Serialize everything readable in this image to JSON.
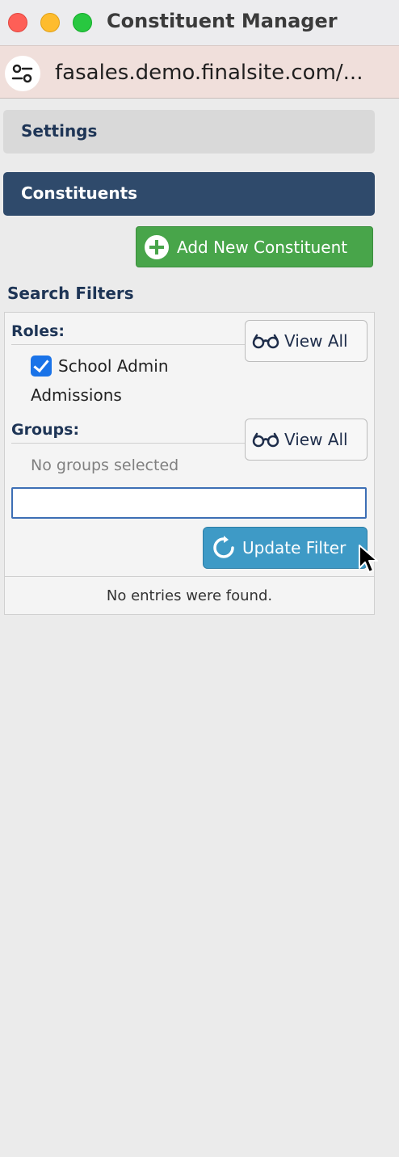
{
  "window": {
    "title": "Constituent Manager",
    "url": "fasales.demo.finalsite.com/..."
  },
  "nav": {
    "settings_label": "Settings",
    "constituents_label": "Constituents"
  },
  "actions": {
    "add_constituent_label": "Add New Constituent",
    "add_icon": "plus-circle-icon"
  },
  "filters": {
    "heading": "Search Filters",
    "roles": {
      "label": "Roles:",
      "view_all_label": "View All",
      "selected": [
        {
          "text_line1": "School Admin",
          "text_line2": "Admissions",
          "checked": true
        }
      ]
    },
    "groups": {
      "label": "Groups:",
      "view_all_label": "View All",
      "empty_text": "No groups selected"
    },
    "search_input": {
      "value": "",
      "placeholder": ""
    },
    "update_label": "Update Filter",
    "update_icon": "refresh-icon",
    "view_all_icon": "glasses-icon"
  },
  "results": {
    "empty_text": "No entries were found."
  },
  "colors": {
    "nav_active": "#2f4a6b",
    "add_button": "#48a54a",
    "update_button": "#3e9ac6",
    "heading_text": "#1e3556"
  }
}
